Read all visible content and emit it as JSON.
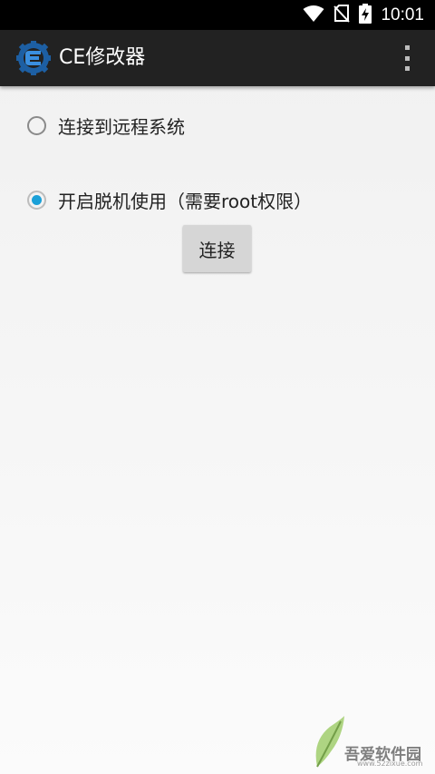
{
  "status_bar": {
    "time": "10:01",
    "icons": [
      "wifi-icon",
      "no-sim-icon",
      "battery-charging-icon"
    ]
  },
  "action_bar": {
    "title": "CE修改器",
    "logo_icon": "cheat-engine-logo",
    "menu_icon": "overflow-menu-icon"
  },
  "options": [
    {
      "label": "连接到远程系统",
      "checked": false
    },
    {
      "label": "开启脱机使用（需要root权限）",
      "checked": true
    }
  ],
  "connect_button": {
    "label": "连接"
  },
  "watermark": {
    "text": "吾爱软件园",
    "url": "www.52zixue.com"
  },
  "colors": {
    "accent": "#1aa0d8",
    "action_bar": "#222222",
    "status_bar": "#000000"
  }
}
